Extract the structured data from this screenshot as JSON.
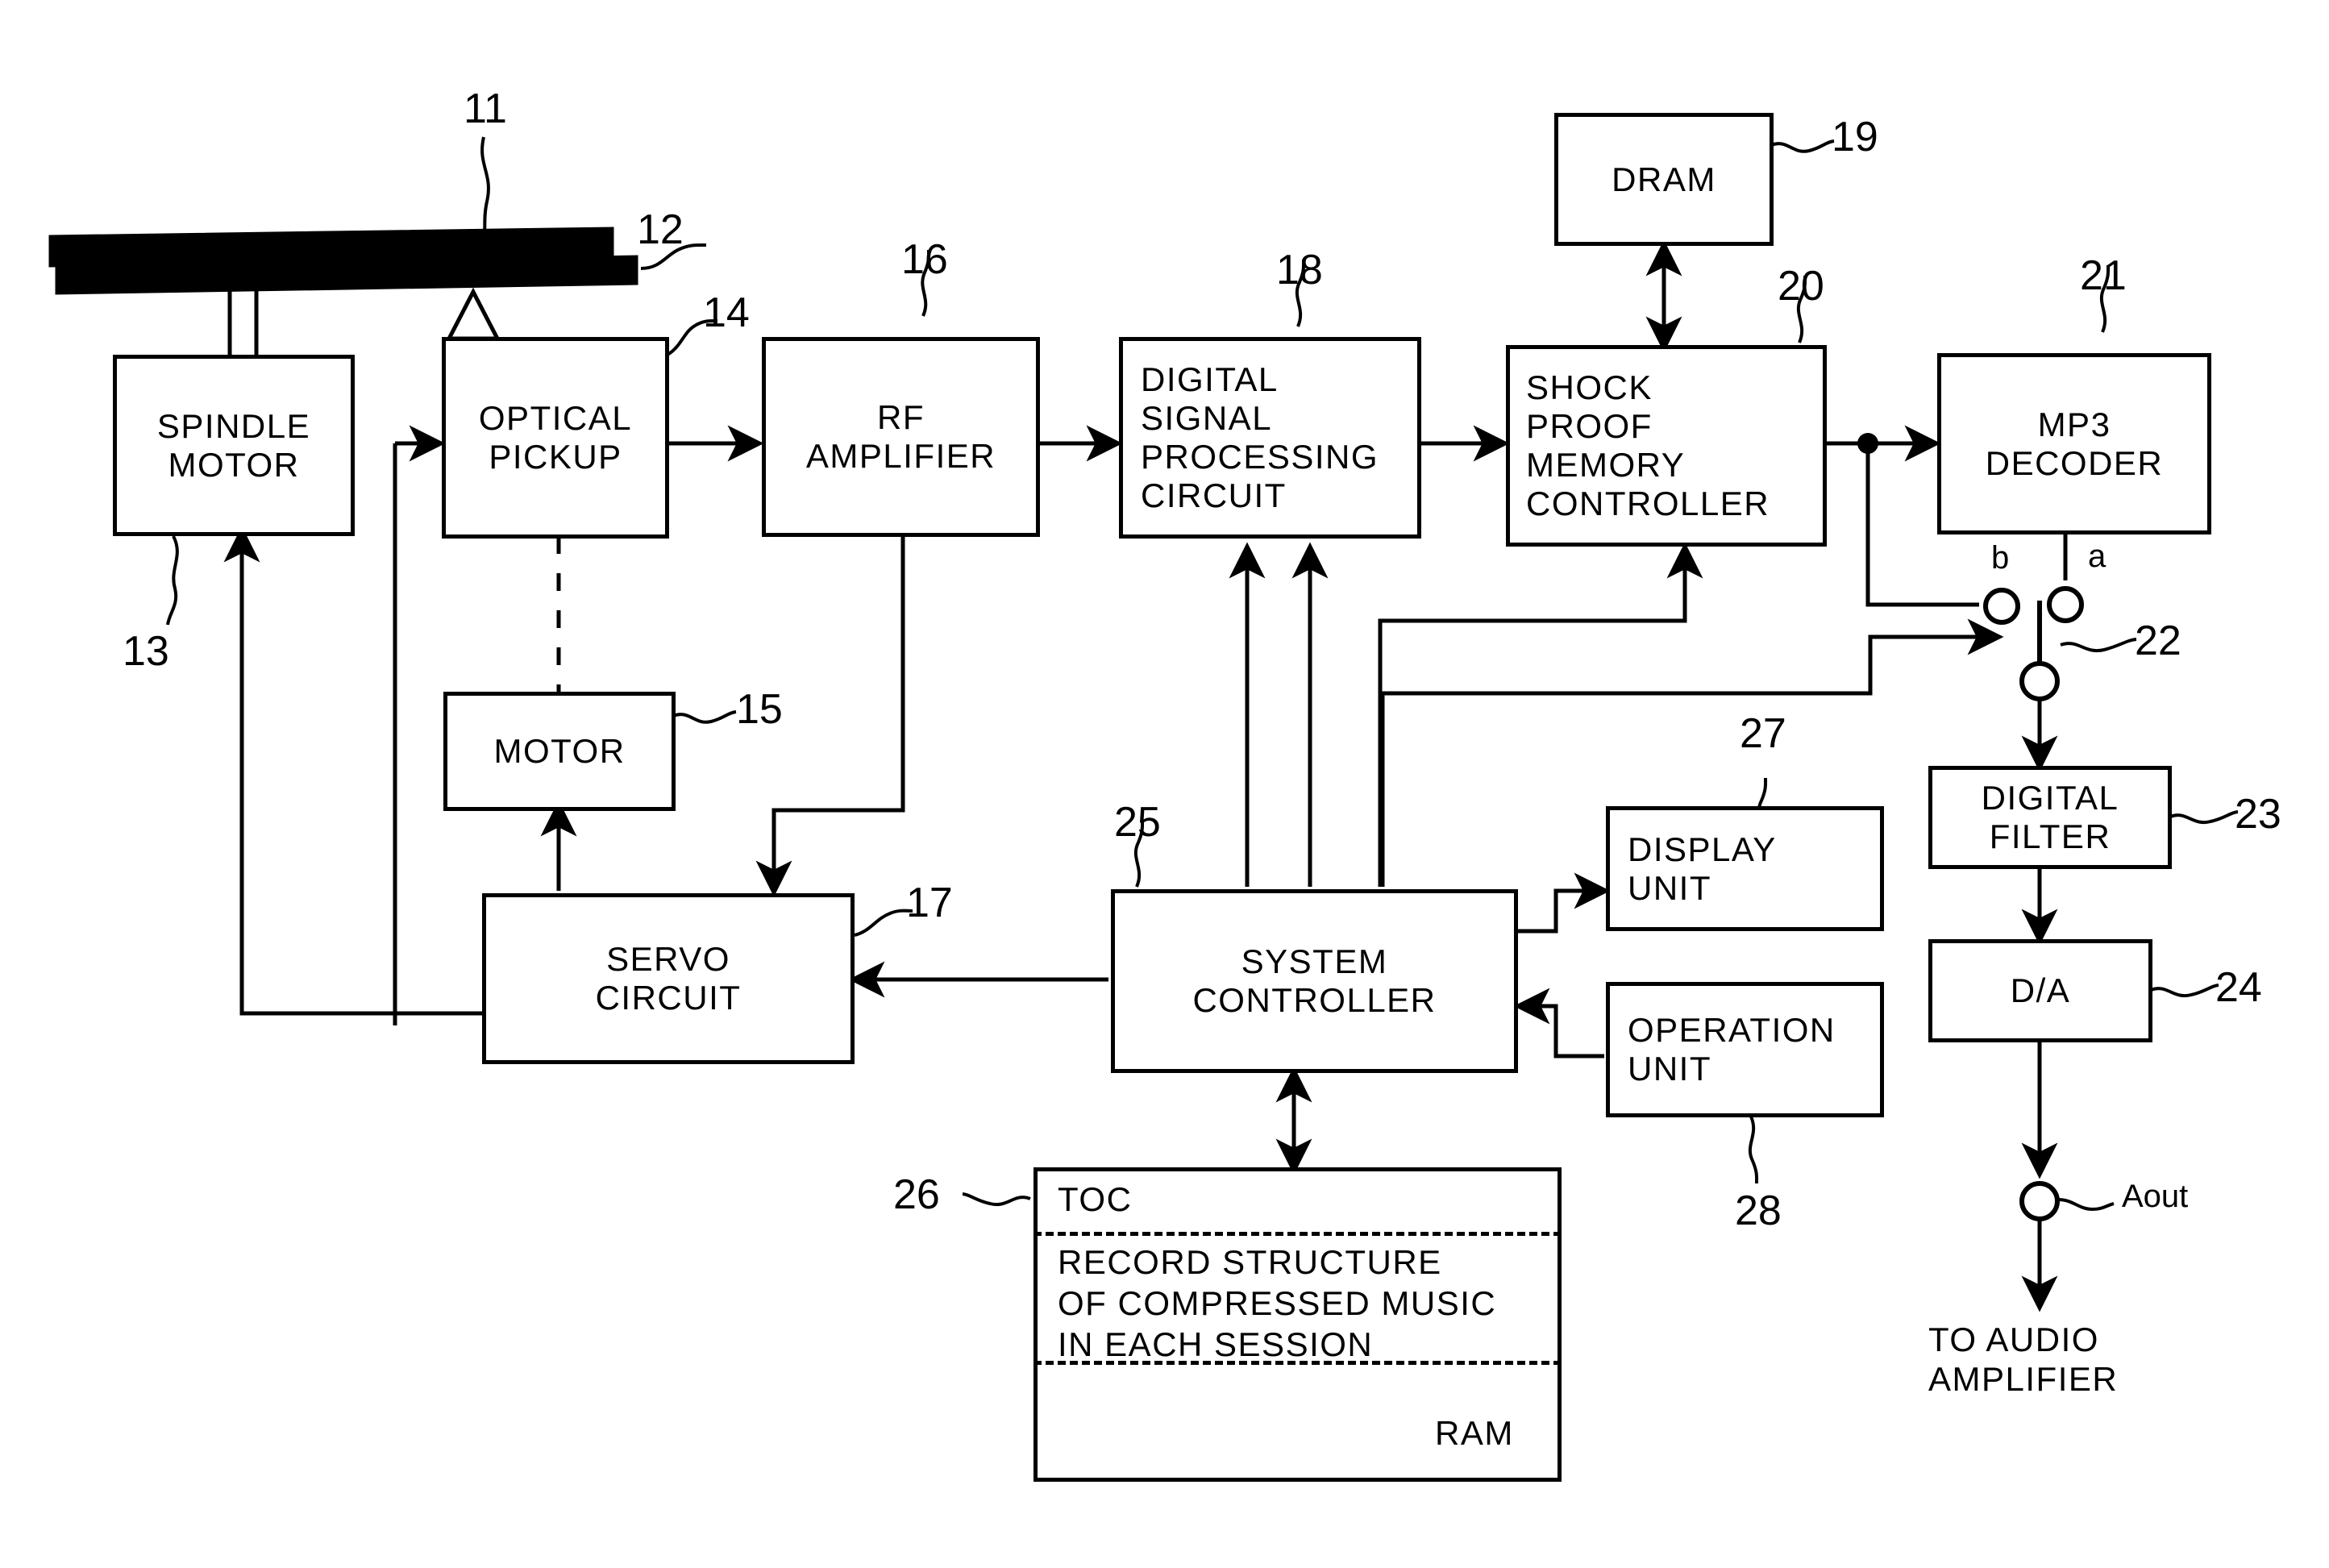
{
  "figure": {
    "type": "patent-block-diagram",
    "subject": "Optical disc player signal path block diagram"
  },
  "blocks": [
    {
      "id": "spindle_motor",
      "label": "SPINDLE\nMOTOR",
      "ref": "13"
    },
    {
      "id": "optical_pickup",
      "label": "OPTICAL\nPICKUP",
      "ref": "14"
    },
    {
      "id": "motor",
      "label": "MOTOR",
      "ref": "15"
    },
    {
      "id": "rf_amplifier",
      "label": "RF\nAMPLIFIER",
      "ref": "16"
    },
    {
      "id": "servo_circuit",
      "label": "SERVO\nCIRCUIT",
      "ref": "17"
    },
    {
      "id": "dsp_circuit",
      "label": "DIGITAL\nSIGNAL\nPROCESSING\nCIRCUIT",
      "ref": "18"
    },
    {
      "id": "dram",
      "label": "DRAM",
      "ref": "19"
    },
    {
      "id": "shock_proof",
      "label": "SHOCK\nPROOF\nMEMORY\nCONTROLLER",
      "ref": "20"
    },
    {
      "id": "mp3_decoder",
      "label": "MP3\nDECODER",
      "ref": "21"
    },
    {
      "id": "digital_filter",
      "label": "DIGITAL\nFILTER",
      "ref": "23"
    },
    {
      "id": "da_converter",
      "label": "D/A",
      "ref": "24"
    },
    {
      "id": "system_ctrl",
      "label": "SYSTEM\nCONTROLLER",
      "ref": "25"
    },
    {
      "id": "display_unit",
      "label": "DISPLAY\nUNIT",
      "ref": "27"
    },
    {
      "id": "operation_unit",
      "label": "OPERATION\nUNIT",
      "ref": "28"
    }
  ],
  "disc": {
    "ref_top": "11",
    "ref_bottom": "12"
  },
  "switch": {
    "ref": "22",
    "terminal_b": "b",
    "terminal_a": "a"
  },
  "ram": {
    "ref": "26",
    "toc": "TOC",
    "record_structure": "RECORD STRUCTURE\nOF COMPRESSED MUSIC\nIN EACH SESSION",
    "ram_label": "RAM"
  },
  "output": {
    "aout": "Aout",
    "destination": "TO AUDIO\nAMPLIFIER"
  },
  "colors": {
    "ink": "#000000",
    "paper": "#ffffff"
  }
}
